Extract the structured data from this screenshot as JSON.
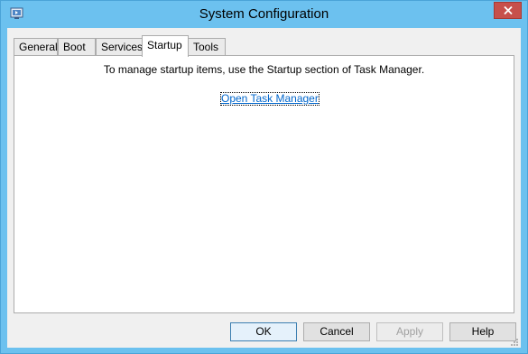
{
  "window": {
    "title": "System Configuration",
    "icon": "msconfig-icon",
    "close_icon": "close-icon",
    "accent_color": "#6cc1ef",
    "close_color": "#c7504b"
  },
  "tabs": [
    {
      "label": "General"
    },
    {
      "label": "Boot"
    },
    {
      "label": "Services"
    },
    {
      "label": "Startup",
      "active": true
    },
    {
      "label": "Tools"
    }
  ],
  "startup": {
    "message": "To manage startup items, use the Startup section of Task Manager.",
    "link_label": "Open Task Manager"
  },
  "buttons": {
    "ok": "OK",
    "cancel": "Cancel",
    "apply": "Apply",
    "help": "Help"
  }
}
